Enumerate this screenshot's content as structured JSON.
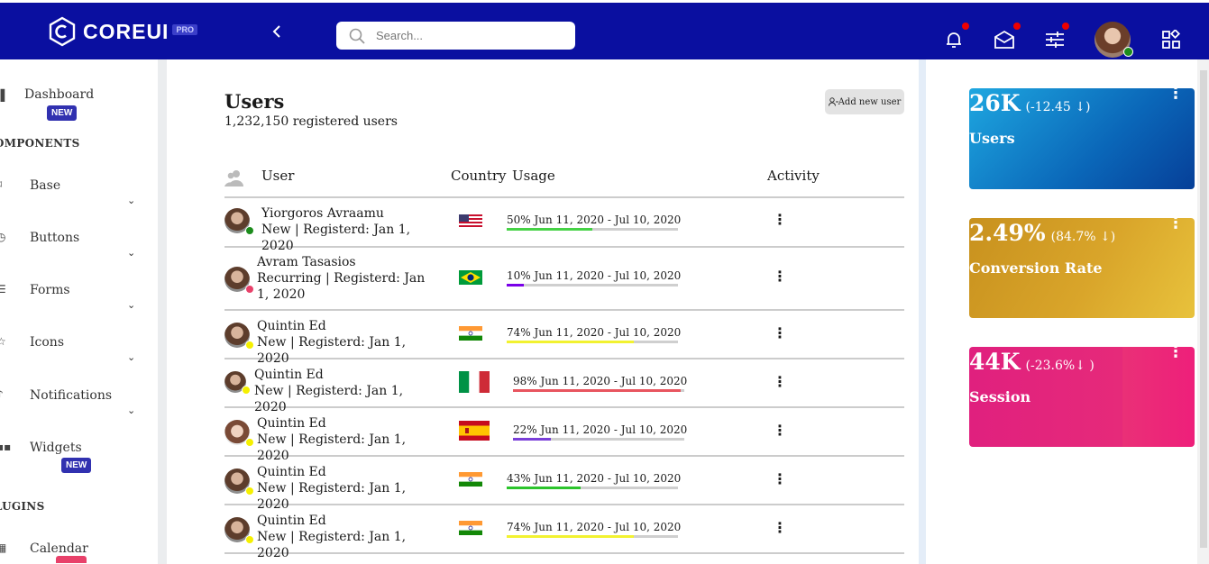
{
  "brand": {
    "name": "COREUI",
    "badge": "PRO"
  },
  "header": {
    "back_icon": "chevron-left-icon",
    "search_placeholder": "Search...",
    "icons": [
      "bell-icon",
      "envelope-icon",
      "sliders-icon",
      "apps-icon"
    ],
    "notification_color": "#e00000",
    "bar_color": "#0a0fa0"
  },
  "sidebar": {
    "dashboard": {
      "label": "Dashboard",
      "badge": "NEW"
    },
    "components_title": "OMPONENTS",
    "items": [
      {
        "label": "Base"
      },
      {
        "label": "Buttons"
      },
      {
        "label": "Forms"
      },
      {
        "label": "Icons"
      },
      {
        "label": "Notifications"
      },
      {
        "label": "Widgets",
        "badge": "NEW"
      }
    ],
    "plugins_title": "LUGINS",
    "calendar": "Calendar"
  },
  "users": {
    "title": "Users",
    "subtitle": "1,232,150 registered users",
    "add_button": "Add new user",
    "columns": {
      "user": "User",
      "country": "Country",
      "usage": "Usage",
      "activity": "Activity"
    },
    "rows": [
      {
        "name": "Yiorgoros Avraamu",
        "meta": "New | Registerd: Jan 1, 2020",
        "status": "#1c8c1c",
        "country": "us",
        "usage_pct": 50,
        "usage_text": "50% Jun 11, 2020 - Jul 10, 2020",
        "usage_color": "#46d246"
      },
      {
        "name": "Avram Tasasios",
        "meta": "Recurring | Registerd: Jan 1, 2020",
        "status": "#e8416a",
        "country": "br",
        "usage_pct": 10,
        "usage_text": "10% Jun 11, 2020 - Jul 10, 2020",
        "usage_color": "#7a00e8"
      },
      {
        "name": "Quintin Ed",
        "meta": "New | Registerd: Jan 1, 2020",
        "status": "#f5f000",
        "country": "in",
        "usage_pct": 74,
        "usage_text": "74% Jun 11, 2020 - Jul 10, 2020",
        "usage_color": "#f2f230"
      },
      {
        "name": "Quintin Ed",
        "meta": "New | Registerd: Jan 1, 2020",
        "status": "#f5f000",
        "country": "it",
        "usage_pct": 98,
        "usage_text": "98% Jun 11, 2020 - Jul 10, 2020",
        "usage_color": "#e8555f"
      },
      {
        "name": "Quintin Ed",
        "meta": "New | Registerd: Jan 1, 2020",
        "status": "#f5f000",
        "country": "es",
        "usage_pct": 22,
        "usage_text": "22% Jun 11, 2020 - Jul 10, 2020",
        "usage_color": "#7a3fd8"
      },
      {
        "name": "Quintin Ed",
        "meta": "New | Registerd: Jan 1, 2020",
        "status": "#f5f000",
        "country": "in",
        "usage_pct": 43,
        "usage_text": "43% Jun 11, 2020 - Jul 10, 2020",
        "usage_color": "#2cc42c"
      },
      {
        "name": "Quintin Ed",
        "meta": "New | Registerd: Jan 1, 2020",
        "status": "#f5f000",
        "country": "in",
        "usage_pct": 74,
        "usage_text": "74% Jun 11, 2020 - Jul 10, 2020",
        "usage_color": "#f2f230"
      }
    ]
  },
  "widgets": [
    {
      "value": "26K",
      "change": "(-12.45 ↓)",
      "label": "Users"
    },
    {
      "value": "2.49%",
      "change": "(84.7% ↓)",
      "label": "Conversion Rate"
    },
    {
      "value": "44K",
      "change": "(-23.6%↓ )",
      "label": "Session"
    }
  ]
}
